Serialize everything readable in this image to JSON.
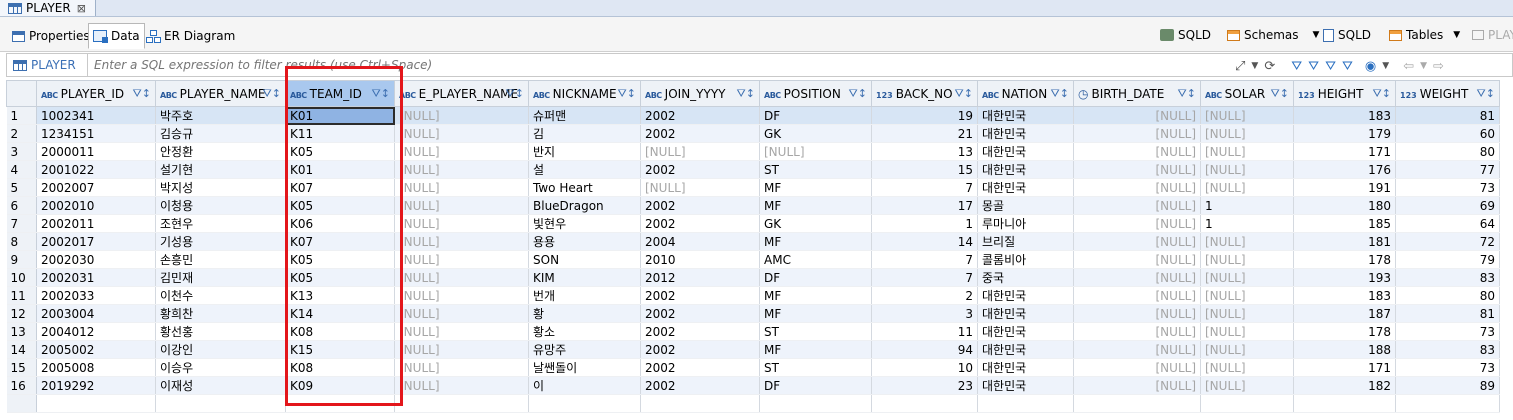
{
  "editor_tab": {
    "title": "PLAYER",
    "close": "⊠"
  },
  "subtabs": [
    "Properties",
    "Data",
    "ER Diagram"
  ],
  "toolbar_right": {
    "conn1": "SQLD",
    "schemas": "Schemas",
    "conn2": "SQLD",
    "tables": "Tables",
    "extra": "PLAY"
  },
  "filter": {
    "label": "PLAYER",
    "placeholder": "Enter a SQL expression to filter results (use Ctrl+Space)"
  },
  "null_text": "[NULL]",
  "columns": [
    {
      "name": "PLAYER_ID",
      "type": "abc"
    },
    {
      "name": "PLAYER_NAME",
      "type": "abc"
    },
    {
      "name": "TEAM_ID",
      "type": "abc"
    },
    {
      "name": "E_PLAYER_NAME",
      "type": "abc"
    },
    {
      "name": "NICKNAME",
      "type": "abc"
    },
    {
      "name": "JOIN_YYYY",
      "type": "abc"
    },
    {
      "name": "POSITION",
      "type": "abc"
    },
    {
      "name": "BACK_NO",
      "type": "123"
    },
    {
      "name": "NATION",
      "type": "abc"
    },
    {
      "name": "BIRTH_DATE",
      "type": "date"
    },
    {
      "name": "SOLAR",
      "type": "abc"
    },
    {
      "name": "HEIGHT",
      "type": "123"
    },
    {
      "name": "WEIGHT",
      "type": "123"
    }
  ],
  "rows": [
    [
      "1002341",
      "박주호",
      "K01",
      null,
      "슈퍼맨",
      "2002",
      "DF",
      "19",
      "대한민국",
      null,
      null,
      "183",
      "81"
    ],
    [
      "1234151",
      "김승규",
      "K11",
      null,
      "김",
      "2002",
      "GK",
      "21",
      "대한민국",
      null,
      null,
      "179",
      "60"
    ],
    [
      "2000011",
      "안정환",
      "K05",
      null,
      "반지",
      null,
      null,
      "13",
      "대한민국",
      null,
      null,
      "171",
      "80"
    ],
    [
      "2001022",
      "설기현",
      "K01",
      null,
      "설",
      "2002",
      "ST",
      "15",
      "대한민국",
      null,
      null,
      "176",
      "77"
    ],
    [
      "2002007",
      "박지성",
      "K07",
      null,
      "Two Heart",
      null,
      "MF",
      "7",
      "대한민국",
      null,
      null,
      "191",
      "73"
    ],
    [
      "2002010",
      "이청용",
      "K05",
      null,
      "BlueDragon",
      "2002",
      "MF",
      "17",
      "몽골",
      null,
      "1",
      "180",
      "69"
    ],
    [
      "2002011",
      "조현우",
      "K06",
      null,
      "빛현우",
      "2002",
      "GK",
      "1",
      "루마니아",
      null,
      "1",
      "185",
      "64"
    ],
    [
      "2002017",
      "기성용",
      "K07",
      null,
      "용용",
      "2004",
      "MF",
      "14",
      "브리질",
      null,
      null,
      "181",
      "72"
    ],
    [
      "2002030",
      "손흥민",
      "K05",
      null,
      "SON",
      "2010",
      "AMC",
      "7",
      "콜롬비아",
      null,
      null,
      "178",
      "79"
    ],
    [
      "2002031",
      "김민재",
      "K05",
      null,
      "KIM",
      "2012",
      "DF",
      "7",
      "중국",
      null,
      null,
      "193",
      "83"
    ],
    [
      "2002033",
      "이천수",
      "K13",
      null,
      "번개",
      "2002",
      "MF",
      "2",
      "대한민국",
      null,
      null,
      "183",
      "80"
    ],
    [
      "2003004",
      "황희찬",
      "K14",
      null,
      "황",
      "2002",
      "MF",
      "3",
      "대한민국",
      null,
      null,
      "187",
      "81"
    ],
    [
      "2004012",
      "황선홍",
      "K08",
      null,
      "황소",
      "2002",
      "ST",
      "11",
      "대한민국",
      null,
      null,
      "178",
      "73"
    ],
    [
      "2005002",
      "이강인",
      "K15",
      null,
      "유망주",
      "2002",
      "MF",
      "94",
      "대한민국",
      null,
      null,
      "188",
      "83"
    ],
    [
      "2005008",
      "이승우",
      "K08",
      null,
      "날쌘돌이",
      "2002",
      "ST",
      "10",
      "대한민국",
      null,
      null,
      "171",
      "73"
    ],
    [
      "2019292",
      "이재성",
      "K09",
      null,
      "이",
      "2002",
      "DF",
      "23",
      "대한민국",
      null,
      null,
      "182",
      "89"
    ]
  ]
}
